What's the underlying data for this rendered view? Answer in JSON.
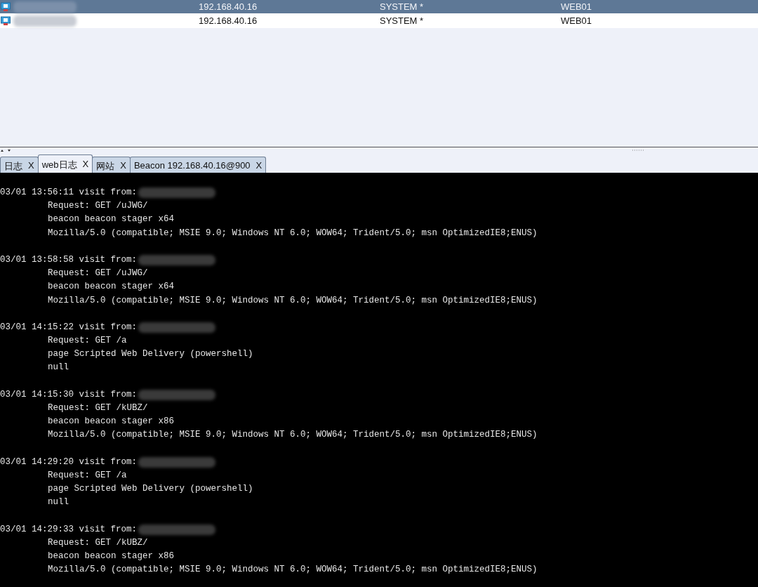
{
  "sessions_table": {
    "rows": [
      {
        "selected": true,
        "cells": [
          "192.168.40.16",
          "SYSTEM *",
          "WEB01"
        ]
      },
      {
        "selected": false,
        "cells": [
          "192.168.40.16",
          "SYSTEM *",
          "WEB01"
        ]
      }
    ]
  },
  "tabs": [
    {
      "label": "日志",
      "close": "X",
      "selected": false
    },
    {
      "label": "web日志",
      "close": "X",
      "selected": true
    },
    {
      "label": "网站",
      "close": "X",
      "selected": false
    },
    {
      "label": "Beacon 192.168.40.16@900",
      "close": "X",
      "selected": false
    }
  ],
  "web_log": [
    {
      "header": "03/01 13:56:11 visit from:",
      "lines": [
        "Request: GET /uJWG/",
        "beacon beacon stager x64",
        "Mozilla/5.0 (compatible; MSIE 9.0; Windows NT 6.0; WOW64; Trident/5.0; msn OptimizedIE8;ENUS)"
      ]
    },
    {
      "header": "03/01 13:58:58 visit from:",
      "lines": [
        "Request: GET /uJWG/",
        "beacon beacon stager x64",
        "Mozilla/5.0 (compatible; MSIE 9.0; Windows NT 6.0; WOW64; Trident/5.0; msn OptimizedIE8;ENUS)"
      ]
    },
    {
      "header": "03/01 14:15:22 visit from:",
      "lines": [
        "Request: GET /a",
        "page Scripted Web Delivery (powershell)",
        "null"
      ]
    },
    {
      "header": "03/01 14:15:30 visit from:",
      "lines": [
        "Request: GET /kUBZ/",
        "beacon beacon stager x86",
        "Mozilla/5.0 (compatible; MSIE 9.0; Windows NT 6.0; WOW64; Trident/5.0; msn OptimizedIE8;ENUS)"
      ]
    },
    {
      "header": "03/01 14:29:20 visit from:",
      "lines": [
        "Request: GET /a",
        "page Scripted Web Delivery (powershell)",
        "null"
      ]
    },
    {
      "header": "03/01 14:29:33 visit from:",
      "lines": [
        "Request: GET /kUBZ/",
        "beacon beacon stager x86",
        "Mozilla/5.0 (compatible; MSIE 9.0; Windows NT 6.0; WOW64; Trident/5.0; msn OptimizedIE8;ENUS)"
      ]
    }
  ]
}
